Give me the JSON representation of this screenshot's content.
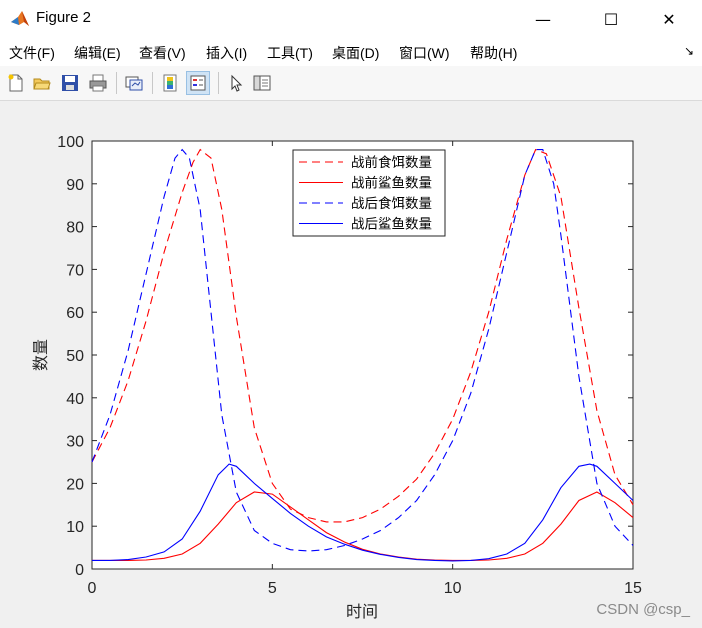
{
  "window": {
    "title": "Figure 2",
    "minimize": "—",
    "maximize": "☐",
    "close": "✕"
  },
  "menu": [
    {
      "label": "文件(F)"
    },
    {
      "label": "编辑(E)"
    },
    {
      "label": "查看(V)"
    },
    {
      "label": "插入(I)"
    },
    {
      "label": "工具(T)"
    },
    {
      "label": "桌面(D)"
    },
    {
      "label": "窗口(W)"
    },
    {
      "label": "帮助(H)"
    }
  ],
  "toolbar": [
    "new-figure-icon",
    "open-folder-icon",
    "save-icon",
    "print-icon",
    "link-plot-icon",
    "colorbar-icon",
    "legend-icon",
    "pointer-icon",
    "property-editor-icon"
  ],
  "watermark": "CSDN @csp_",
  "chart_data": {
    "type": "line",
    "xlabel": "时间",
    "ylabel": "数量",
    "xlim": [
      0,
      15
    ],
    "ylim": [
      0,
      100
    ],
    "xticks": [
      0,
      5,
      10,
      15
    ],
    "yticks": [
      0,
      10,
      20,
      30,
      40,
      50,
      60,
      70,
      80,
      90,
      100
    ],
    "grid": false,
    "legend_position": "top-center",
    "series": [
      {
        "name": "战前食饵数量",
        "color": "#ff0000",
        "dash": "dashed",
        "x": [
          0,
          0.5,
          1,
          1.5,
          2,
          2.5,
          2.8,
          3.0,
          3.3,
          3.6,
          4,
          4.5,
          5,
          5.5,
          6,
          6.5,
          7,
          7.5,
          8,
          8.5,
          9,
          9.5,
          10,
          10.5,
          11,
          11.5,
          12,
          12.3,
          12.6,
          13,
          13.5,
          14,
          14.5,
          15
        ],
        "y": [
          25,
          33,
          44,
          58,
          74,
          88,
          95,
          98,
          96,
          84,
          59,
          33,
          20,
          14,
          12,
          11,
          11,
          12,
          14,
          17,
          21,
          27,
          35,
          46,
          60,
          77,
          92,
          98,
          97,
          87,
          61,
          37,
          22,
          15
        ]
      },
      {
        "name": "战前鲨鱼数量",
        "color": "#ff0000",
        "dash": "solid",
        "x": [
          0,
          0.5,
          1,
          1.5,
          2,
          2.5,
          3,
          3.5,
          4,
          4.5,
          5,
          5.5,
          6,
          6.5,
          7,
          7.5,
          8,
          8.5,
          9,
          9.5,
          10,
          10.5,
          11,
          11.5,
          12,
          12.5,
          13,
          13.5,
          14,
          14.5,
          15
        ],
        "y": [
          2,
          2,
          2,
          2.1,
          2.5,
          3.5,
          6,
          10.5,
          15.5,
          18,
          17.5,
          14.5,
          11.5,
          8.5,
          6.3,
          4.6,
          3.5,
          2.8,
          2.3,
          2.1,
          2,
          2,
          2.1,
          2.5,
          3.5,
          6,
          10.5,
          16,
          18,
          15.5,
          12
        ]
      },
      {
        "name": "战后食饵数量",
        "color": "#0000ff",
        "dash": "dashed",
        "x": [
          0,
          0.5,
          1,
          1.5,
          2,
          2.3,
          2.5,
          2.7,
          3,
          3.3,
          3.6,
          4,
          4.5,
          5,
          5.5,
          6,
          6.5,
          7,
          7.5,
          8,
          8.5,
          9,
          9.5,
          10,
          10.5,
          11,
          11.5,
          12,
          12.3,
          12.5,
          12.8,
          13,
          13.5,
          14,
          14.5,
          15
        ],
        "y": [
          25,
          36,
          51,
          69,
          87,
          96,
          98,
          96,
          84,
          60,
          36,
          18,
          9,
          6,
          4.5,
          4.2,
          4.5,
          5.5,
          7,
          9,
          12,
          16,
          22,
          30,
          41,
          56,
          74,
          92,
          98,
          98,
          90,
          78,
          45,
          20,
          10,
          5.5
        ]
      },
      {
        "name": "战后鲨鱼数量",
        "color": "#0000ff",
        "dash": "solid",
        "x": [
          0,
          0.5,
          1,
          1.5,
          2,
          2.5,
          3,
          3.5,
          3.8,
          4,
          4.5,
          5,
          5.5,
          6,
          6.5,
          7,
          7.5,
          8,
          8.5,
          9,
          9.5,
          10,
          10.5,
          11,
          11.5,
          12,
          12.5,
          13,
          13.5,
          13.8,
          14,
          14.5,
          15
        ],
        "y": [
          2,
          2,
          2.2,
          2.8,
          4,
          7,
          13.5,
          22,
          24.5,
          24,
          20,
          16.5,
          13,
          10,
          7.5,
          5.8,
          4.4,
          3.4,
          2.7,
          2.2,
          2,
          1.9,
          2,
          2.4,
          3.5,
          6,
          11.5,
          19,
          24,
          24.5,
          24,
          20,
          16
        ]
      }
    ]
  }
}
